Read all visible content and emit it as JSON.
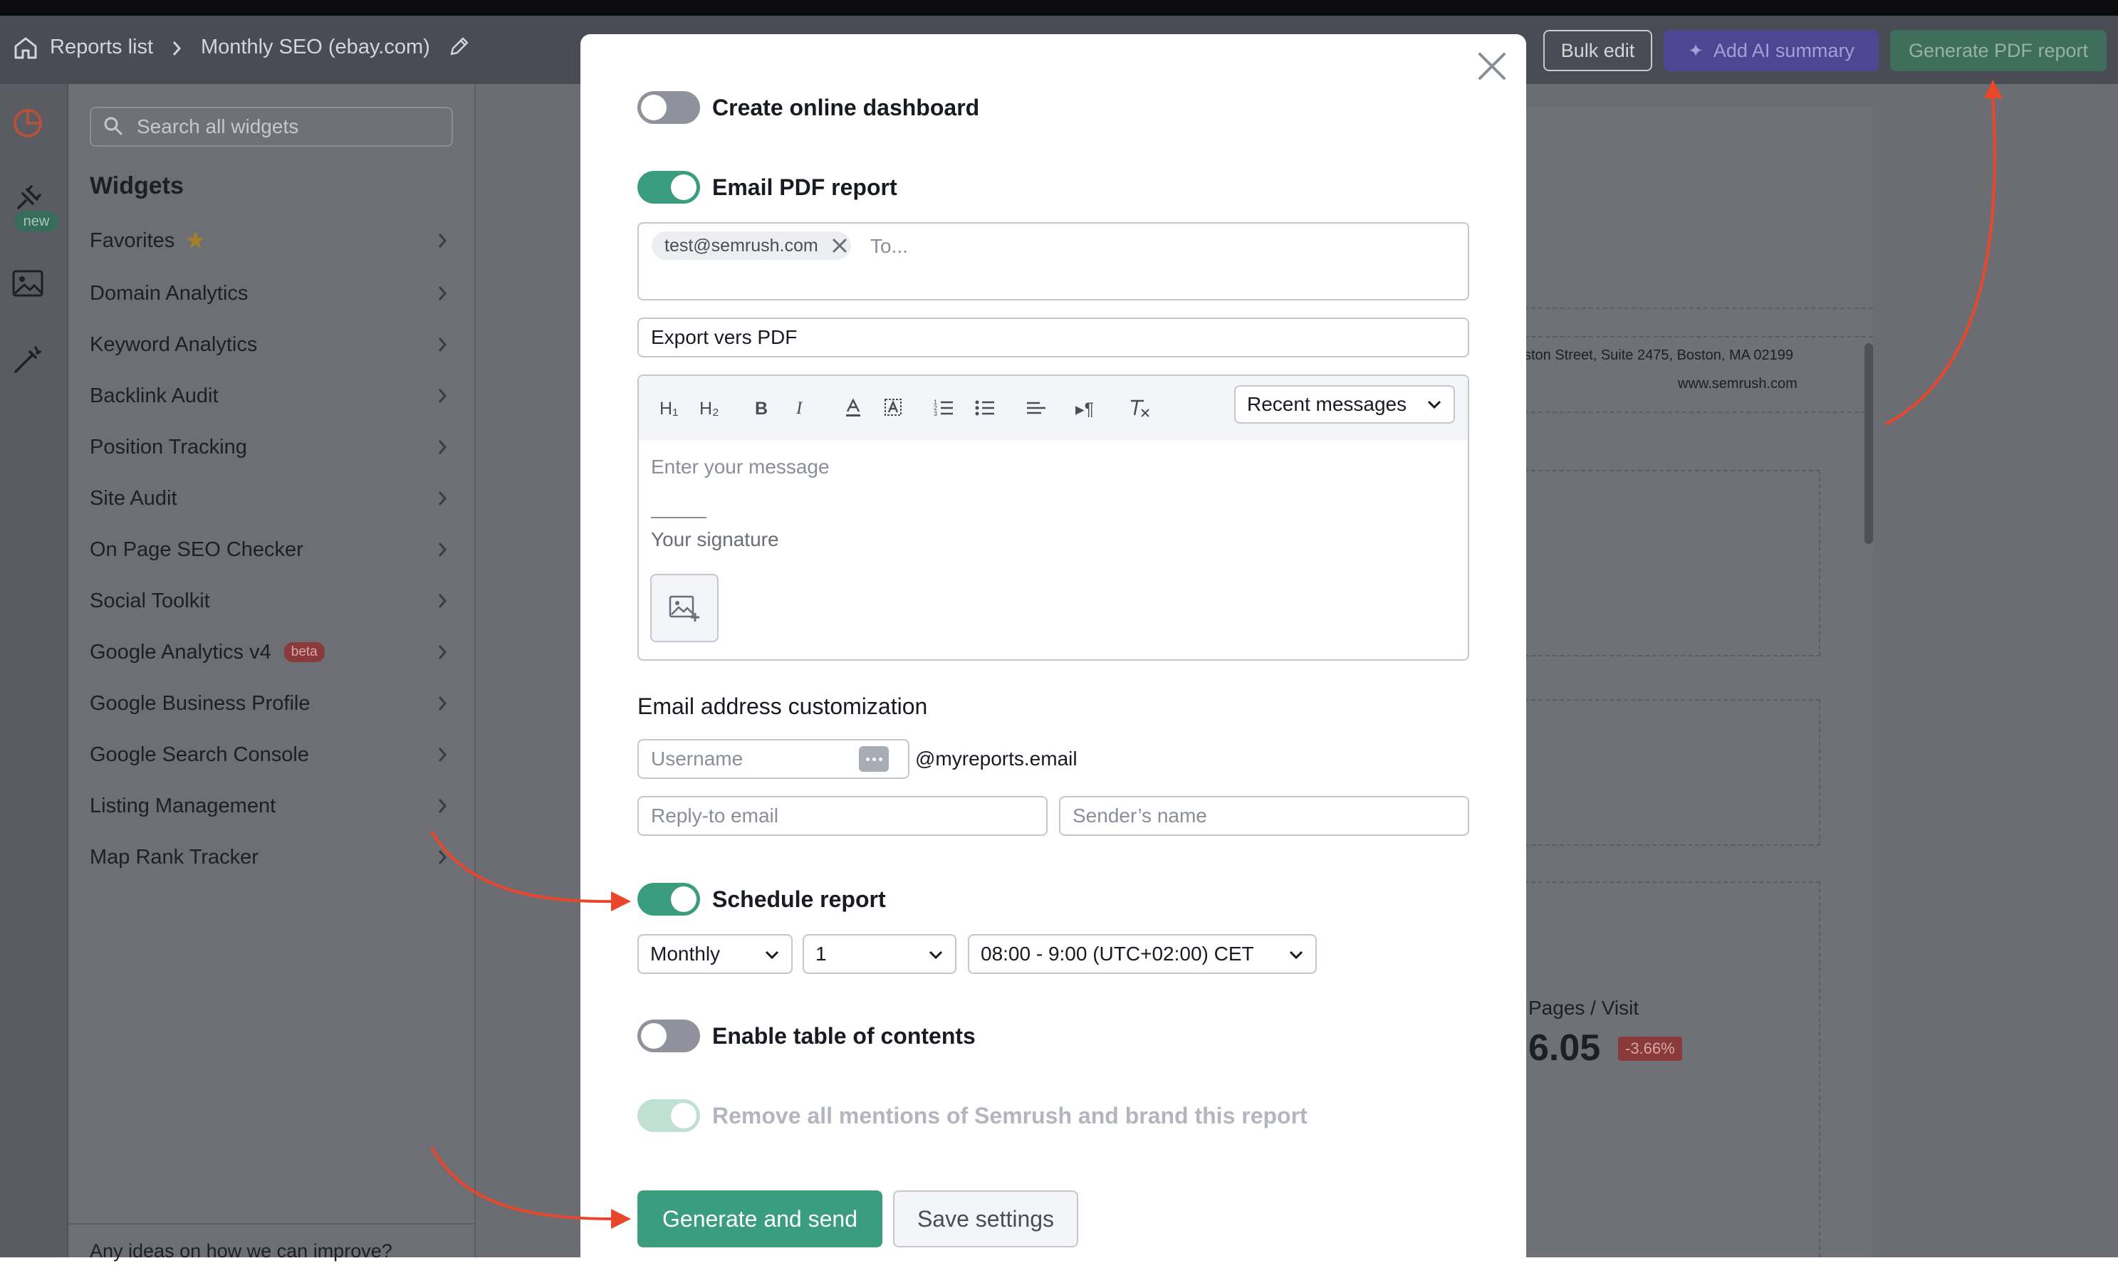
{
  "header": {
    "breadcrumb_root": "Reports list",
    "breadcrumb_current": "Monthly SEO (ebay.com)",
    "bulk_edit": "Bulk edit",
    "ai_summary": "Add AI summary",
    "generate_pdf": "Generate PDF report"
  },
  "rail": {
    "new_badge": "new"
  },
  "sidebar": {
    "search_placeholder": "Search all widgets",
    "title": "Widgets",
    "items": [
      {
        "label": "Favorites"
      },
      {
        "label": "Domain Analytics"
      },
      {
        "label": "Keyword Analytics"
      },
      {
        "label": "Backlink Audit"
      },
      {
        "label": "Position Tracking"
      },
      {
        "label": "Site Audit"
      },
      {
        "label": "On Page SEO Checker"
      },
      {
        "label": "Social Toolkit"
      },
      {
        "label": "Google Analytics v4",
        "badge": "beta"
      },
      {
        "label": "Google Business Profile"
      },
      {
        "label": "Google Search Console"
      },
      {
        "label": "Listing Management"
      },
      {
        "label": "Map Rank Tracker"
      }
    ],
    "footer": "Any ideas on how we can improve?"
  },
  "background": {
    "address": "ston Street, Suite 2475, Boston, MA 02199",
    "website": "www.semrush.com",
    "metric_label": "Pages / Visit",
    "metric_value": "6.05",
    "metric_delta": "-3.66%"
  },
  "modal": {
    "online_dashboard": "Create online dashboard",
    "email_pdf": "Email PDF report",
    "recipient": "test@semrush.com",
    "to_placeholder": "To...",
    "subject": "Export vers PDF",
    "toolbar": {
      "h1": "H₁",
      "h2": "H₂",
      "bold": "B",
      "italic": "I",
      "paragraph": "¶"
    },
    "recent_messages": "Recent messages",
    "message_placeholder": "Enter your message",
    "signature_placeholder": "Your signature",
    "email_customization_title": "Email address customization",
    "username_placeholder": "Username",
    "domain_suffix": "@myreports.email",
    "reply_to_placeholder": "Reply-to email",
    "sender_placeholder": "Sender’s name",
    "schedule_report": "Schedule report",
    "frequency": "Monthly",
    "day": "1",
    "time_slot": "08:00 - 9:00 (UTC+02:00) CET",
    "table_of_contents": "Enable table of contents",
    "remove_mentions": "Remove all mentions of Semrush and brand this report",
    "generate_send": "Generate and send",
    "save_settings": "Save settings"
  },
  "colors": {
    "accent_green": "#3a9d7e",
    "annotation_red": "#e8472b",
    "ai_purple": "#5b54c9"
  }
}
